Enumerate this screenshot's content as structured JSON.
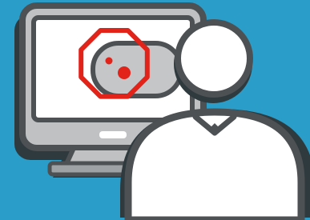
{
  "illustration": {
    "icons": [
      "monitor-icon",
      "stop-sign-icon",
      "user-icon"
    ],
    "colors": {
      "background": "#2a9dc9",
      "shadow": "#2f3a3e",
      "outline": "#4d5154",
      "monitor_body": "#bfc1c3",
      "screen": "#ffffff",
      "stop_sign": "#e2231a",
      "person": "#ffffff"
    }
  }
}
